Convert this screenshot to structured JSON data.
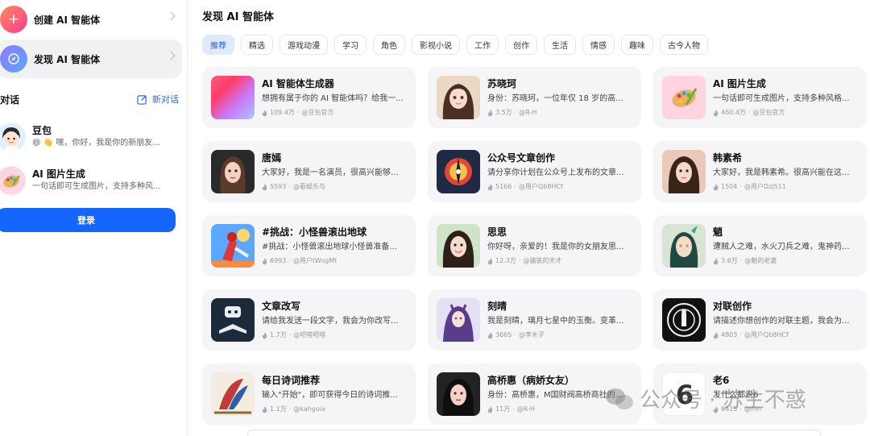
{
  "sidebar": {
    "create_label": "创建 AI 智能体",
    "discover_label": "发现 AI 智能体",
    "conversations_title": "对话",
    "new_chat_label": "新对话",
    "conversations": [
      {
        "name": "豆包",
        "message": "😄 👋 嘿，你好，我是你的新朋友..."
      },
      {
        "name": "AI 图片生成",
        "message": "一句话即可生成图片，支持多种风..."
      }
    ],
    "login_label": "登录"
  },
  "main": {
    "title": "发现 AI 智能体",
    "tags": [
      "推荐",
      "精选",
      "游戏动漫",
      "学习",
      "角色",
      "影视小说",
      "工作",
      "创作",
      "生活",
      "情感",
      "趣味",
      "古今人物"
    ],
    "active_tag": "推荐",
    "cards": [
      {
        "title": "AI 智能体生成器",
        "desc": "想拥有属于你的 AI 智能体吗？给我一...",
        "count": "109.4万",
        "author": "@豆包官方"
      },
      {
        "title": "苏晓珂",
        "desc": "身份：苏晓珂，一位年仅 18 岁的高...",
        "count": "3.5万",
        "author": "@R-H"
      },
      {
        "title": "AI 图片生成",
        "desc": "一句话即可生成图片，支持多种风格...",
        "count": "460.4万",
        "author": "@豆包官方"
      },
      {
        "title": "唐嫣",
        "desc": "大家好，我是一名演员，很高兴能够...",
        "count": "5593",
        "author": "@看娱乐与"
      },
      {
        "title": "公众号文章创作",
        "desc": "请分享你计划在公众号上发布的文章...",
        "count": "5166",
        "author": "@用户Qb8HCf"
      },
      {
        "title": "韩素希",
        "desc": "大家好，我是韩素希。很高兴能在这...",
        "count": "1504",
        "author": "@用户Dzj511"
      },
      {
        "title": "#挑战：小怪兽滚出地球",
        "desc": "#挑战：小怪兽滚出地球小怪兽准备...",
        "count": "6993",
        "author": "@用户tWsgMt"
      },
      {
        "title": "思思",
        "desc": "你好呀，亲爱的！我是你的女朋友思...",
        "count": "12.3万",
        "author": "@骗装的天才"
      },
      {
        "title": "魈",
        "desc": "遭贼人之难，水火刀兵之难，鬼神药...",
        "count": "3.6万",
        "author": "@魈的老婆"
      },
      {
        "title": "文章改写",
        "desc": "请给我发送一段文字，我会为你改写...",
        "count": "1.7万",
        "author": "@吧嗒吧嗒"
      },
      {
        "title": "刻晴",
        "desc": "我是刻晴，璃月七星中的玉衡。变革...",
        "count": "3665",
        "author": "@李木子"
      },
      {
        "title": "对联创作",
        "desc": "请描述你想创作的对联主题，我会为...",
        "count": "4803",
        "author": "@用户Qb8HCf"
      },
      {
        "title": "每日诗词推荐",
        "desc": "输入\"开始\"，即可获得今日的诗词推...",
        "count": "1.1万",
        "author": "@kahgoia"
      },
      {
        "title": "高桥惠（病娇女友）",
        "desc": "身份：高桥惠，M国财阀高桥商社的...",
        "count": "11万",
        "author": "@R-H"
      },
      {
        "title": "老6",
        "desc": "发什么都说6",
        "count": "6415",
        "author": "@fnn"
      }
    ]
  },
  "watermark": "公众号 · 苏生不惑",
  "colors": {
    "accent": "#1566ff",
    "card_bg": "#f5f5f7",
    "tag_active_bg": "#dfeaff"
  }
}
